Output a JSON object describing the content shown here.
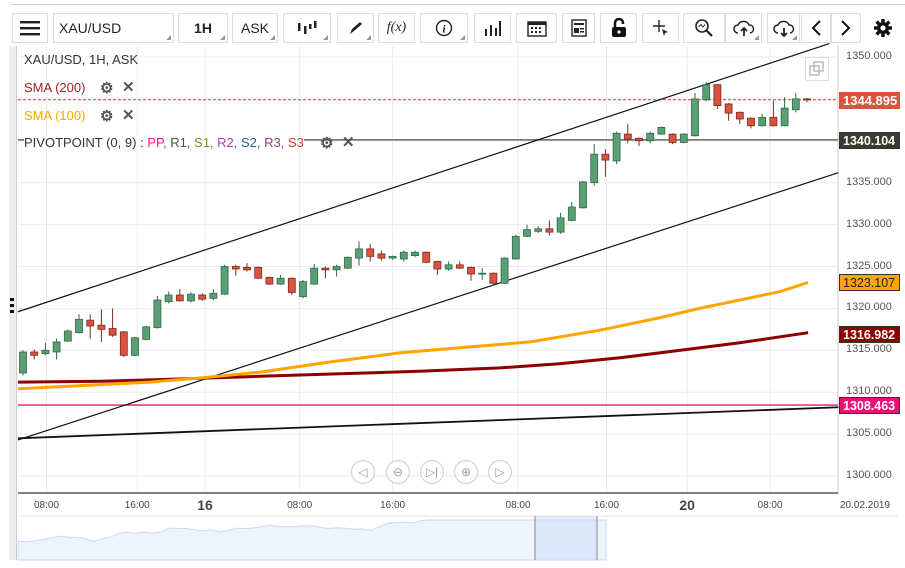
{
  "toolbar": {
    "menu_icon": "hamburger-icon",
    "symbol": "XAU/USD",
    "timeframe": "1H",
    "price_side": "ASK",
    "buttons": [
      "chart-type",
      "draw",
      "indicators-fx",
      "info",
      "volume",
      "calendar",
      "news",
      "lock",
      "crosshair",
      "zoom",
      "upload",
      "download",
      "scroll-left",
      "scroll-right",
      "settings"
    ],
    "fx_label": "f(x)"
  },
  "legend": {
    "title": "XAU/USD, 1H, ASK",
    "sma200": "SMA (200)",
    "sma100": "SMA (100)",
    "pivot": "PIVOTPOINT (0, 9)",
    "pivot_sep": " : ",
    "pivot_levels": [
      {
        "t": "PP",
        "c": "#ff1a75"
      },
      {
        "t": "R1",
        "c": "#555533"
      },
      {
        "t": "S1",
        "c": "#8a8a22"
      },
      {
        "t": "R2",
        "c": "#aa44aa"
      },
      {
        "t": "S2",
        "c": "#226688"
      },
      {
        "t": "R3",
        "c": "#884488"
      },
      {
        "t": "S3",
        "c": "#cc4433"
      }
    ]
  },
  "colors": {
    "up": "#5a9e76",
    "down": "#d9533f",
    "sma100": "#ffa500",
    "sma200": "#8b0000",
    "pivot": "#e6127a",
    "last": "#d9533f"
  },
  "chart_data": {
    "type": "candlestick",
    "title": "XAU/USD, 1H, ASK",
    "ylim": [
      1298,
      1352
    ],
    "y_ticks": [
      "1350.000",
      "1345.000",
      "1340.000",
      "1335.000",
      "1330.000",
      "1325.000",
      "1320.000",
      "1315.000",
      "1310.000",
      "1305.000",
      "1300.000"
    ],
    "y_tick_values": [
      1350,
      1345,
      1340,
      1335,
      1330,
      1325,
      1320,
      1315,
      1310,
      1305,
      1300
    ],
    "x_ticks": [
      {
        "i": 2.1,
        "t": "08:00"
      },
      {
        "i": 10.2,
        "t": "16:00"
      },
      {
        "i": 16.25,
        "t": "16",
        "major": true
      },
      {
        "i": 24.7,
        "t": "08:00"
      },
      {
        "i": 33,
        "t": "16:00"
      },
      {
        "i": 44.2,
        "t": "08:00"
      },
      {
        "i": 52.1,
        "t": "16:00"
      },
      {
        "i": 59.3,
        "t": "20",
        "major": true
      },
      {
        "i": 66.7,
        "t": "08:00"
      }
    ],
    "x_last_label": "20.02.2019",
    "candles": [
      [
        1312.3,
        1314.8,
        1315.0,
        1312.0
      ],
      [
        1314.8,
        1314.4,
        1315.1,
        1313.9
      ],
      [
        1314.6,
        1315.0,
        1315.9,
        1314.4
      ],
      [
        1314.8,
        1316.0,
        1316.4,
        1313.9
      ],
      [
        1316.1,
        1317.3,
        1317.5,
        1316.0
      ],
      [
        1317.1,
        1318.7,
        1319.3,
        1317.0
      ],
      [
        1318.6,
        1317.9,
        1319.3,
        1316.4
      ],
      [
        1318.0,
        1317.5,
        1319.9,
        1316.0
      ],
      [
        1317.6,
        1316.8,
        1320.0,
        1316.6
      ],
      [
        1317.2,
        1314.4,
        1317.3,
        1314.2
      ],
      [
        1314.4,
        1316.5,
        1316.6,
        1314.3
      ],
      [
        1316.3,
        1317.8,
        1317.9,
        1316.2
      ],
      [
        1317.7,
        1321.0,
        1321.5,
        1317.6
      ],
      [
        1320.8,
        1321.6,
        1322.0,
        1320.6
      ],
      [
        1321.6,
        1320.9,
        1322.3,
        1320.8
      ],
      [
        1320.9,
        1321.7,
        1321.9,
        1320.7
      ],
      [
        1321.6,
        1321.1,
        1321.8,
        1320.9
      ],
      [
        1321.2,
        1321.8,
        1322.3,
        1321.0
      ],
      [
        1321.7,
        1325.0,
        1325.2,
        1321.6
      ],
      [
        1325.0,
        1324.7,
        1325.2,
        1323.9
      ],
      [
        1324.9,
        1324.6,
        1325.4,
        1324.4
      ],
      [
        1324.9,
        1323.6,
        1325.0,
        1323.5
      ],
      [
        1323.7,
        1322.9,
        1323.8,
        1322.8
      ],
      [
        1322.9,
        1323.6,
        1324.0,
        1322.8
      ],
      [
        1323.6,
        1321.9,
        1323.7,
        1321.6
      ],
      [
        1321.4,
        1323.2,
        1323.4,
        1321.2
      ],
      [
        1322.9,
        1324.8,
        1325.3,
        1322.8
      ],
      [
        1324.8,
        1324.6,
        1325.0,
        1323.6
      ],
      [
        1324.6,
        1325.0,
        1325.2,
        1323.8
      ],
      [
        1324.8,
        1326.1,
        1326.2,
        1324.7
      ],
      [
        1326.0,
        1327.1,
        1328.0,
        1325.1
      ],
      [
        1327.1,
        1326.2,
        1327.7,
        1325.6
      ],
      [
        1326.5,
        1326.0,
        1326.9,
        1325.7
      ],
      [
        1326.0,
        1326.2,
        1326.3,
        1325.8
      ],
      [
        1325.9,
        1326.7,
        1326.9,
        1325.6
      ],
      [
        1326.3,
        1326.7,
        1326.9,
        1326.1
      ],
      [
        1326.7,
        1325.5,
        1326.8,
        1325.4
      ],
      [
        1325.6,
        1324.7,
        1325.7,
        1324.0
      ],
      [
        1324.7,
        1325.2,
        1325.6,
        1324.5
      ],
      [
        1325.2,
        1324.8,
        1325.6,
        1324.7
      ],
      [
        1324.9,
        1324.1,
        1325.0,
        1323.3
      ],
      [
        1324.1,
        1324.2,
        1324.8,
        1323.4
      ],
      [
        1324.2,
        1323.0,
        1324.3,
        1322.9
      ],
      [
        1323.0,
        1326.0,
        1326.1,
        1322.9
      ],
      [
        1325.9,
        1328.6,
        1328.8,
        1325.8
      ],
      [
        1328.6,
        1329.4,
        1330.0,
        1328.5
      ],
      [
        1329.2,
        1329.5,
        1329.8,
        1329.0
      ],
      [
        1329.5,
        1329.1,
        1330.5,
        1328.7
      ],
      [
        1329.1,
        1330.8,
        1331.4,
        1328.9
      ],
      [
        1330.5,
        1332.1,
        1332.7,
        1330.4
      ],
      [
        1332.0,
        1335.1,
        1335.2,
        1331.9
      ],
      [
        1335.0,
        1338.4,
        1339.6,
        1334.6
      ],
      [
        1338.4,
        1337.7,
        1339.0,
        1335.7
      ],
      [
        1337.6,
        1340.9,
        1341.1,
        1337.2
      ],
      [
        1340.8,
        1340.2,
        1342.0,
        1339.7
      ],
      [
        1340.3,
        1340.0,
        1340.4,
        1339.4
      ],
      [
        1340.0,
        1340.9,
        1341.1,
        1339.7
      ],
      [
        1340.8,
        1341.6,
        1341.7,
        1340.7
      ],
      [
        1340.8,
        1339.8,
        1340.9,
        1339.6
      ],
      [
        1339.8,
        1340.8,
        1340.9,
        1339.7
      ],
      [
        1340.6,
        1345.0,
        1345.7,
        1340.5
      ],
      [
        1344.9,
        1346.7,
        1347.0,
        1344.7
      ],
      [
        1346.7,
        1344.2,
        1346.8,
        1343.8
      ],
      [
        1344.4,
        1343.3,
        1344.5,
        1342.4
      ],
      [
        1343.4,
        1342.6,
        1343.5,
        1342.0
      ],
      [
        1342.7,
        1341.8,
        1342.8,
        1341.5
      ],
      [
        1341.8,
        1342.8,
        1343.2,
        1341.7
      ],
      [
        1342.8,
        1341.8,
        1344.8,
        1341.7
      ],
      [
        1341.8,
        1343.9,
        1345.2,
        1341.7
      ],
      [
        1343.7,
        1345.0,
        1345.7,
        1343.4
      ],
      [
        1345.0,
        1344.9,
        1345.1,
        1344.6
      ]
    ],
    "sma100": [
      [
        -0.45,
        1310.4
      ],
      [
        11.3,
        1311.2
      ],
      [
        15.8,
        1311.7
      ],
      [
        21.2,
        1312.4
      ],
      [
        27.4,
        1313.6
      ],
      [
        33.7,
        1314.7
      ],
      [
        39,
        1315.3
      ],
      [
        45.3,
        1316.0
      ],
      [
        51.5,
        1317.4
      ],
      [
        56.9,
        1318.9
      ],
      [
        60.4,
        1320.0
      ],
      [
        64,
        1321.0
      ],
      [
        67.6,
        1322.0
      ],
      [
        70.1,
        1323.1
      ]
    ],
    "sma200": [
      [
        -0.45,
        1311.2
      ],
      [
        6.9,
        1311.3
      ],
      [
        12.2,
        1311.5
      ],
      [
        21.2,
        1311.9
      ],
      [
        28.3,
        1312.2
      ],
      [
        35.4,
        1312.5
      ],
      [
        42.6,
        1312.9
      ],
      [
        47.9,
        1313.4
      ],
      [
        53.3,
        1314.1
      ],
      [
        58.7,
        1315.0
      ],
      [
        64,
        1315.9
      ],
      [
        70.1,
        1317.1
      ]
    ],
    "trendlines": [
      {
        "name": "channel-upper",
        "p1": [
          -0.45,
          1319.6
        ],
        "p2": [
          72.0,
          1351.6
        ]
      },
      {
        "name": "channel-lower",
        "p1": [
          -0.45,
          1304.3
        ],
        "p2": [
          72.8,
          1336.2
        ]
      },
      {
        "name": "support-line",
        "p1": [
          -0.45,
          1304.5
        ],
        "p2": [
          72.8,
          1308.2
        ]
      }
    ],
    "levels": {
      "last": 1344.895,
      "pivot_pp": 1308.463,
      "gray_line": 1340.104,
      "sma100_last": 1323.107,
      "sma200_last": 1316.982
    },
    "level_labels": {
      "last": "1344.895",
      "pivot_pp": "1308.463",
      "gray_line": "1340.104",
      "sma100_last": "1323.107",
      "sma200_last": "1316.982"
    }
  },
  "navigator": {
    "controls": [
      "scroll-left",
      "zoom-out",
      "go-to-end",
      "zoom-in",
      "scroll-right"
    ]
  }
}
